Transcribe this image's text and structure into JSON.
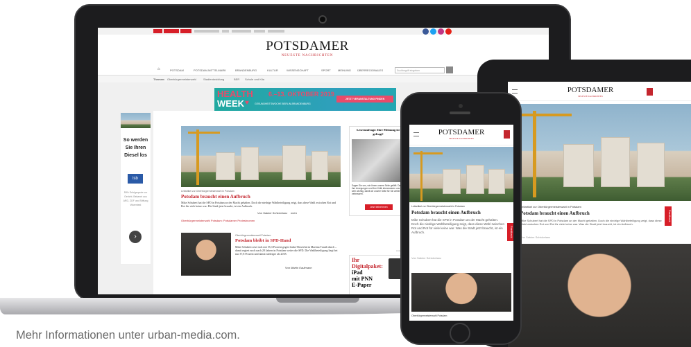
{
  "laptop_site": {
    "logo": "POTSDAMER",
    "tagline": "NEUESTE NACHRICHTEN",
    "nav_items": [
      "POTSDAM",
      "POTSDAM-MITTELMARK",
      "BRANDENBURG",
      "KULTUR",
      "WISSENSCHAFT",
      "SPORT",
      "MEINUNG",
      "ÜBERREGIONALES"
    ],
    "search_placeholder": "Suchbegriff eingeben",
    "topics_label": "Themen:",
    "topics": [
      "Oberbürgermeisterwahl",
      "Stadtentwicklung",
      "BER",
      "Schule und Kita"
    ],
    "banner": {
      "title_top": "HEALTH",
      "title_bottom": "WEEK",
      "dates": "6.–13. OKTOBER 2019",
      "subtitle": "GESUNDHEITSWOCHE BERLIN-BRANDENBURG",
      "cta": "JETZT VERANSTALTUNG FINDEN"
    },
    "sidebar_ad": {
      "headline": "So werden Sie Ihren Diesel los",
      "logo_text": "lsb",
      "body": "55% Erfolgsquote vor Gericht. Bekannt aus ARD, ZDF und Stiftung Warentest"
    },
    "article_main": {
      "kicker": "Leitartikel zur Oberbürgermeisterwahl in Potsdam",
      "headline": "Potsdam braucht einen Aufbruch",
      "teaser": "Mike Schubert hat die SPD in Potsdam an der Macht gehalten. Doch die niedrige Wahlbeteiligung zeigt, dass diese Wahl zwischen Rot und Rot für viele keine war. Die Stadt jetzt braucht, ist ein Aufbruch.",
      "byline": "Von Sabine Schicketanz",
      "more": "mehr",
      "related": "Oberbürgermeisterwahl Potsdam: Potsdamer Protestnomen"
    },
    "article_second": {
      "kicker": "Oberbürgermeisterwahl Potsdam",
      "headline": "Potsdam bleibt in SPD-Hand",
      "teaser": "Mike Schubert setzt sich mit 55,3 Prozent gegen Linke-Bewerberin Martina Trauth durch – damit regiert noch nach 28 Jahren in Potsdam weiter die SPD. Die Wahlbeteiligung liegt bei nur 37,8 Prozent und damit niedriger als 2018.",
      "byline": "Von Martin Kaufmann"
    },
    "poll": {
      "title": "Leserumfrage: Ihre Meinung ist gefragt!",
      "text": "Sagen Sie uns, wie Ihnen unsere Seite gefällt. Dann ihre Anregungen und Ihre Kritik interessieren uns sehr wichtig, damit wir unsere Seite für Sie weiter verbessern.",
      "button": "Jetzt teilnehmen"
    },
    "epaper": {
      "ad_label": "Anzeige",
      "line1": "Ihr",
      "line2": "Digitalpaket:",
      "line3": "iPad",
      "line4": "mit PNN",
      "line5": "E-Paper"
    }
  },
  "tablet_site": {
    "logo": "POTSDAMER",
    "tagline": "NEUESTE NACHRICHTEN",
    "kicker": "Leitartikel zur Oberbürgermeisterwahl in Potsdam",
    "headline": "Potsdam braucht einen Aufbruch",
    "teaser": "Mike Schubert hat die SPD in Potsdam an der Macht gehalten. Doch die niedrige Wahlbeteiligung zeigt, dass diese Wahl zwischen Rot und Rot für viele keine war. Was die Stadt jetzt braucht, ist ein Aufbruch.",
    "byline": "Von Sabine Schicketanz",
    "feedback": "Feedback"
  },
  "phone_site": {
    "logo": "POTSDAMER",
    "tagline": "NEUESTE NACHRICHTEN",
    "kicker": "Leitartikel zur Oberbürgermeisterwahl in Potsdam",
    "headline": "Potsdam braucht einen Aufbruch",
    "teaser": "Mike Schubert hat die SPD in Potsdam an der Macht gehalten. Doch die niedrige Wahlbeteiligung zeigt, dass diese Wahl zwischen Rot und Rot für viele keine war. Was die Stadt jetzt braucht, ist ein Aufbruch.",
    "byline": "Von Sabine Schicketanz",
    "kicker2": "Oberbürgermeisterwahl Potsdam",
    "feedback": "Feedback"
  },
  "footer_text": "Mehr Informationen unter urban-media.com.",
  "colors": {
    "brand_red": "#c4262e",
    "banner_teal": "#21a9a0",
    "device_black": "#1c1c1e"
  },
  "icons": [
    "facebook-icon",
    "twitter-icon",
    "instagram-icon",
    "youtube-icon",
    "home-icon",
    "search-icon",
    "menu-icon",
    "chevron-right-icon"
  ]
}
